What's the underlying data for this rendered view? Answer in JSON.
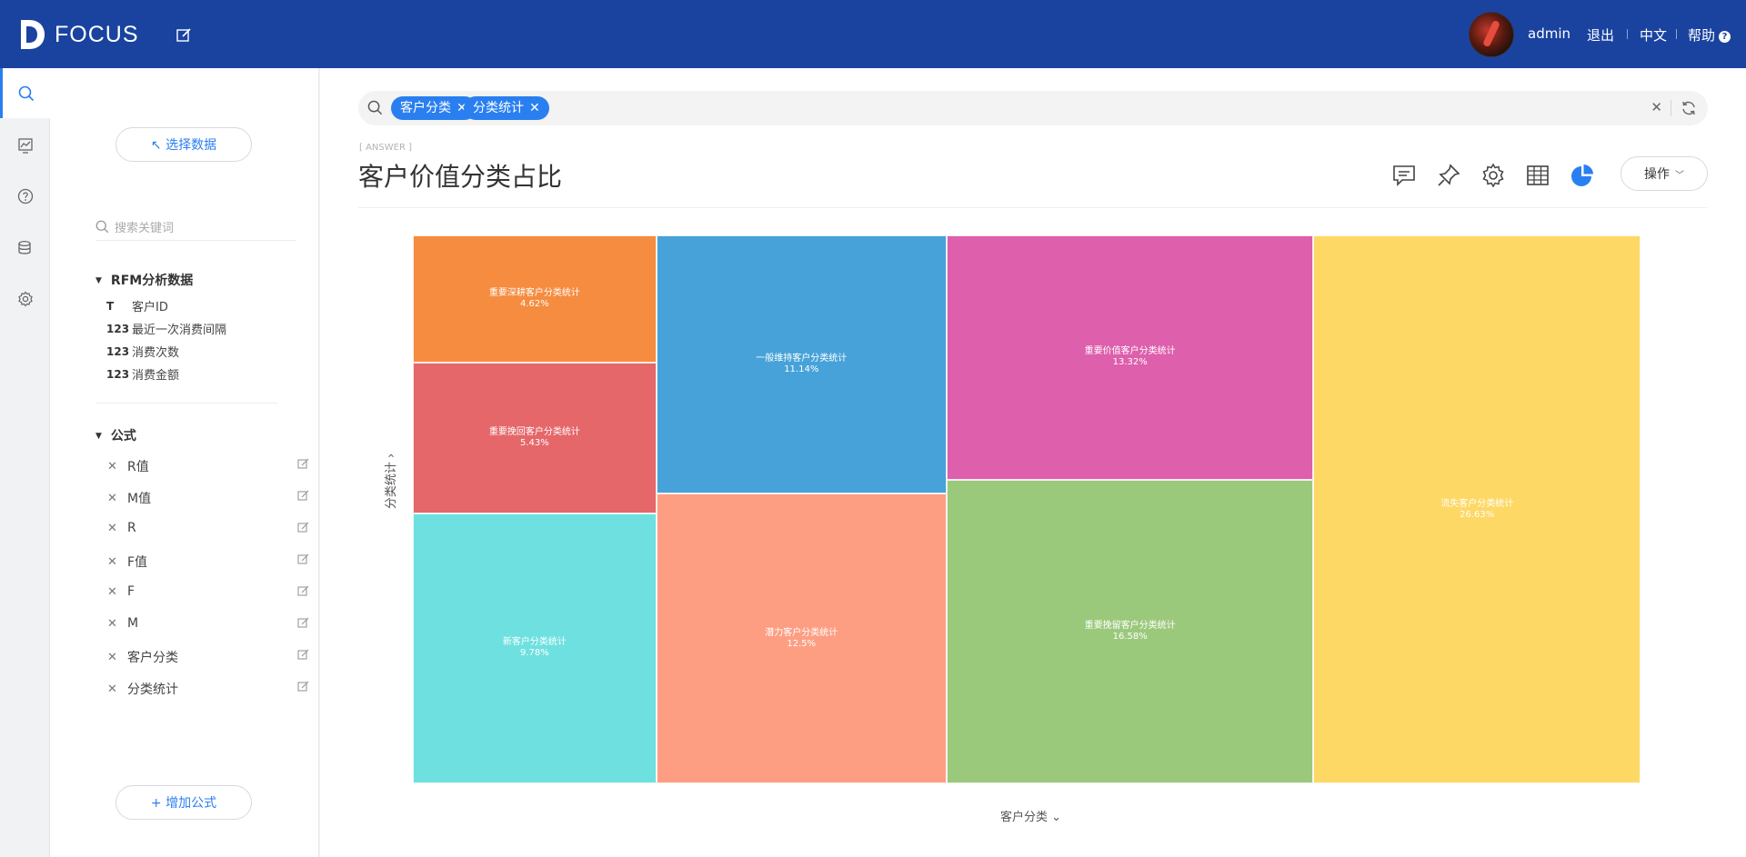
{
  "header": {
    "logo_text": "FOCUS",
    "username": "admin",
    "logout": "退出",
    "language": "中文",
    "help": "帮助",
    "help_badge": "?",
    "bg_color": "#1a43a0"
  },
  "rail": {
    "items": [
      "search-icon",
      "dashboard-icon",
      "help-icon",
      "database-icon",
      "settings-icon"
    ]
  },
  "panel": {
    "select_data_label": "↖ 选择数据",
    "search_placeholder": "搜索关键词",
    "group_rfm": {
      "title": "RFM分析数据",
      "fields": [
        {
          "type": "T",
          "name": "客户ID"
        },
        {
          "type": "123",
          "name": "最近一次消费间隔"
        },
        {
          "type": "123",
          "name": "消费次数"
        },
        {
          "type": "123",
          "name": "消费金额"
        }
      ]
    },
    "group_formula": {
      "title": "公式",
      "items": [
        "R值",
        "M值",
        "R",
        "F值",
        "F",
        "M",
        "客户分类",
        "分类统计"
      ]
    },
    "add_formula_label": "+ 增加公式"
  },
  "main": {
    "search_chips": [
      "客户分类",
      "分类统计"
    ],
    "answer_tag": "[ ANSWER ]",
    "title": "客户价值分类占比",
    "ops_label": "操作",
    "accent": "#2a7ff0"
  },
  "chart_data": {
    "type": "treemap",
    "xlabel": "客户分类",
    "ylabel": "分类统计",
    "items": [
      {
        "name": "重要深耕客户分类统计",
        "percent": "4.62%",
        "value": 4.62,
        "color": "#f58c3f"
      },
      {
        "name": "重要挽回客户分类统计",
        "percent": "5.43%",
        "value": 5.43,
        "color": "#e5676a"
      },
      {
        "name": "新客户分类统计",
        "percent": "9.78%",
        "value": 9.78,
        "color": "#6ee0e0"
      },
      {
        "name": "一般维持客户分类统计",
        "percent": "11.14%",
        "value": 11.14,
        "color": "#46a2d8"
      },
      {
        "name": "潜力客户分类统计",
        "percent": "12.5%",
        "value": 12.5,
        "color": "#fd9e83"
      },
      {
        "name": "重要价值客户分类统计",
        "percent": "13.32%",
        "value": 13.32,
        "color": "#de5fac"
      },
      {
        "name": "重要挽留客户分类统计",
        "percent": "16.58%",
        "value": 16.58,
        "color": "#9bc97c"
      },
      {
        "name": "流失客户分类统计",
        "percent": "26.63%",
        "value": 26.63,
        "color": "#fdd865"
      }
    ]
  }
}
